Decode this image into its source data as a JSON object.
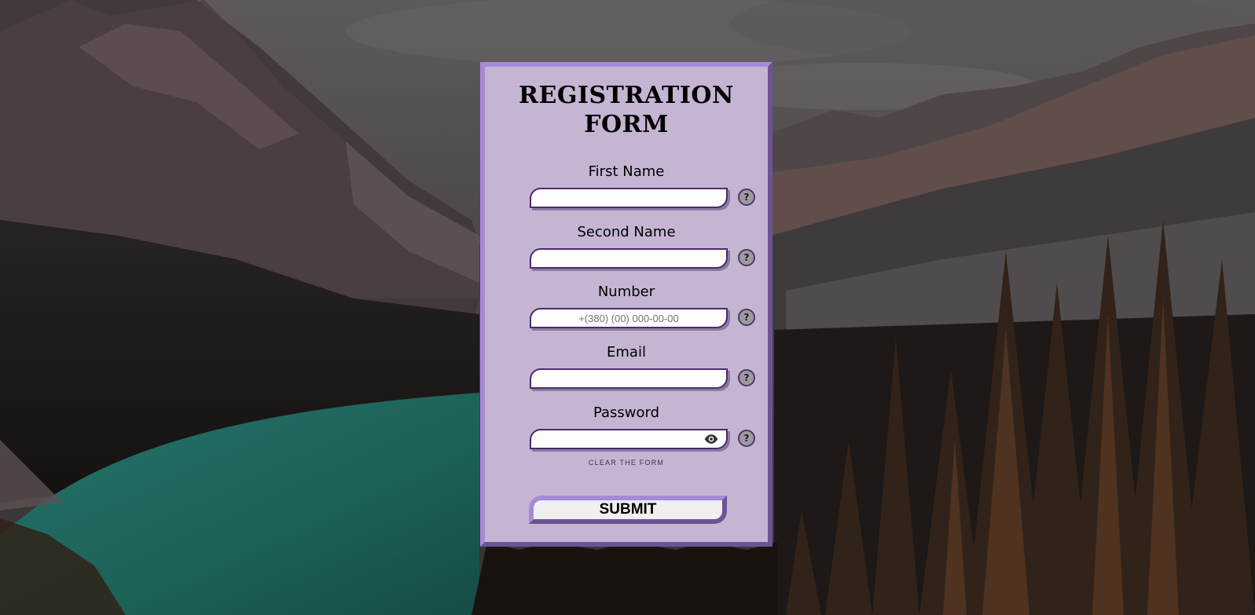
{
  "form": {
    "title": "REGISTRATION FORM",
    "fields": [
      {
        "label": "First Name",
        "value": "",
        "placeholder": "",
        "help": "?"
      },
      {
        "label": "Second Name",
        "value": "",
        "placeholder": "",
        "help": "?"
      },
      {
        "label": "Number",
        "value": "",
        "placeholder": "+(380) (00) 000-00-00",
        "help": "?"
      },
      {
        "label": "Email",
        "value": "",
        "placeholder": "",
        "help": "?"
      },
      {
        "label": "Password",
        "value": "",
        "placeholder": "",
        "help": "?",
        "icon": "eye-icon"
      }
    ],
    "clear_label": "CLEAR THE FORM",
    "submit_label": "SUBMIT"
  },
  "colors": {
    "panel_bg": "#c5b5d3",
    "panel_border_light": "#a789d8",
    "panel_border_dark": "#6c5494",
    "input_border": "#4d2a6a"
  }
}
